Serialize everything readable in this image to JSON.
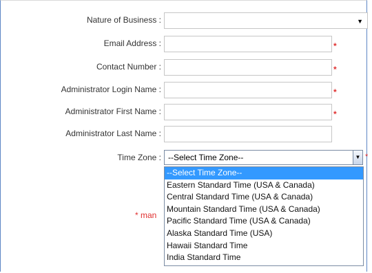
{
  "form": {
    "nature_label": "Nature of Business :",
    "email_label": "Email Address :",
    "contact_label": "Contact Number :",
    "login_label": "Administrator Login Name :",
    "first_label": "Administrator First Name :",
    "last_label": "Administrator Last Name :",
    "timezone_label": "Time Zone :",
    "required_mark": "*",
    "timezone_value": "--Select Time Zone--",
    "mandatory_note": "* man",
    "caret_glyph": "▼"
  },
  "timezone_options": [
    "--Select Time Zone--",
    "Eastern Standard Time (USA & Canada)",
    "Central Standard Time (USA & Canada)",
    "Mountain Standard Time (USA & Canada)",
    "Pacific Standard Time (USA & Canada)",
    "Alaska Standard Time (USA)",
    "Hawaii Standard Time",
    "India Standard Time"
  ],
  "selected_option_index": 0,
  "colors": {
    "required": "#e03030",
    "selected_bg": "#3399ff",
    "frame_border": "#5b85c4"
  }
}
